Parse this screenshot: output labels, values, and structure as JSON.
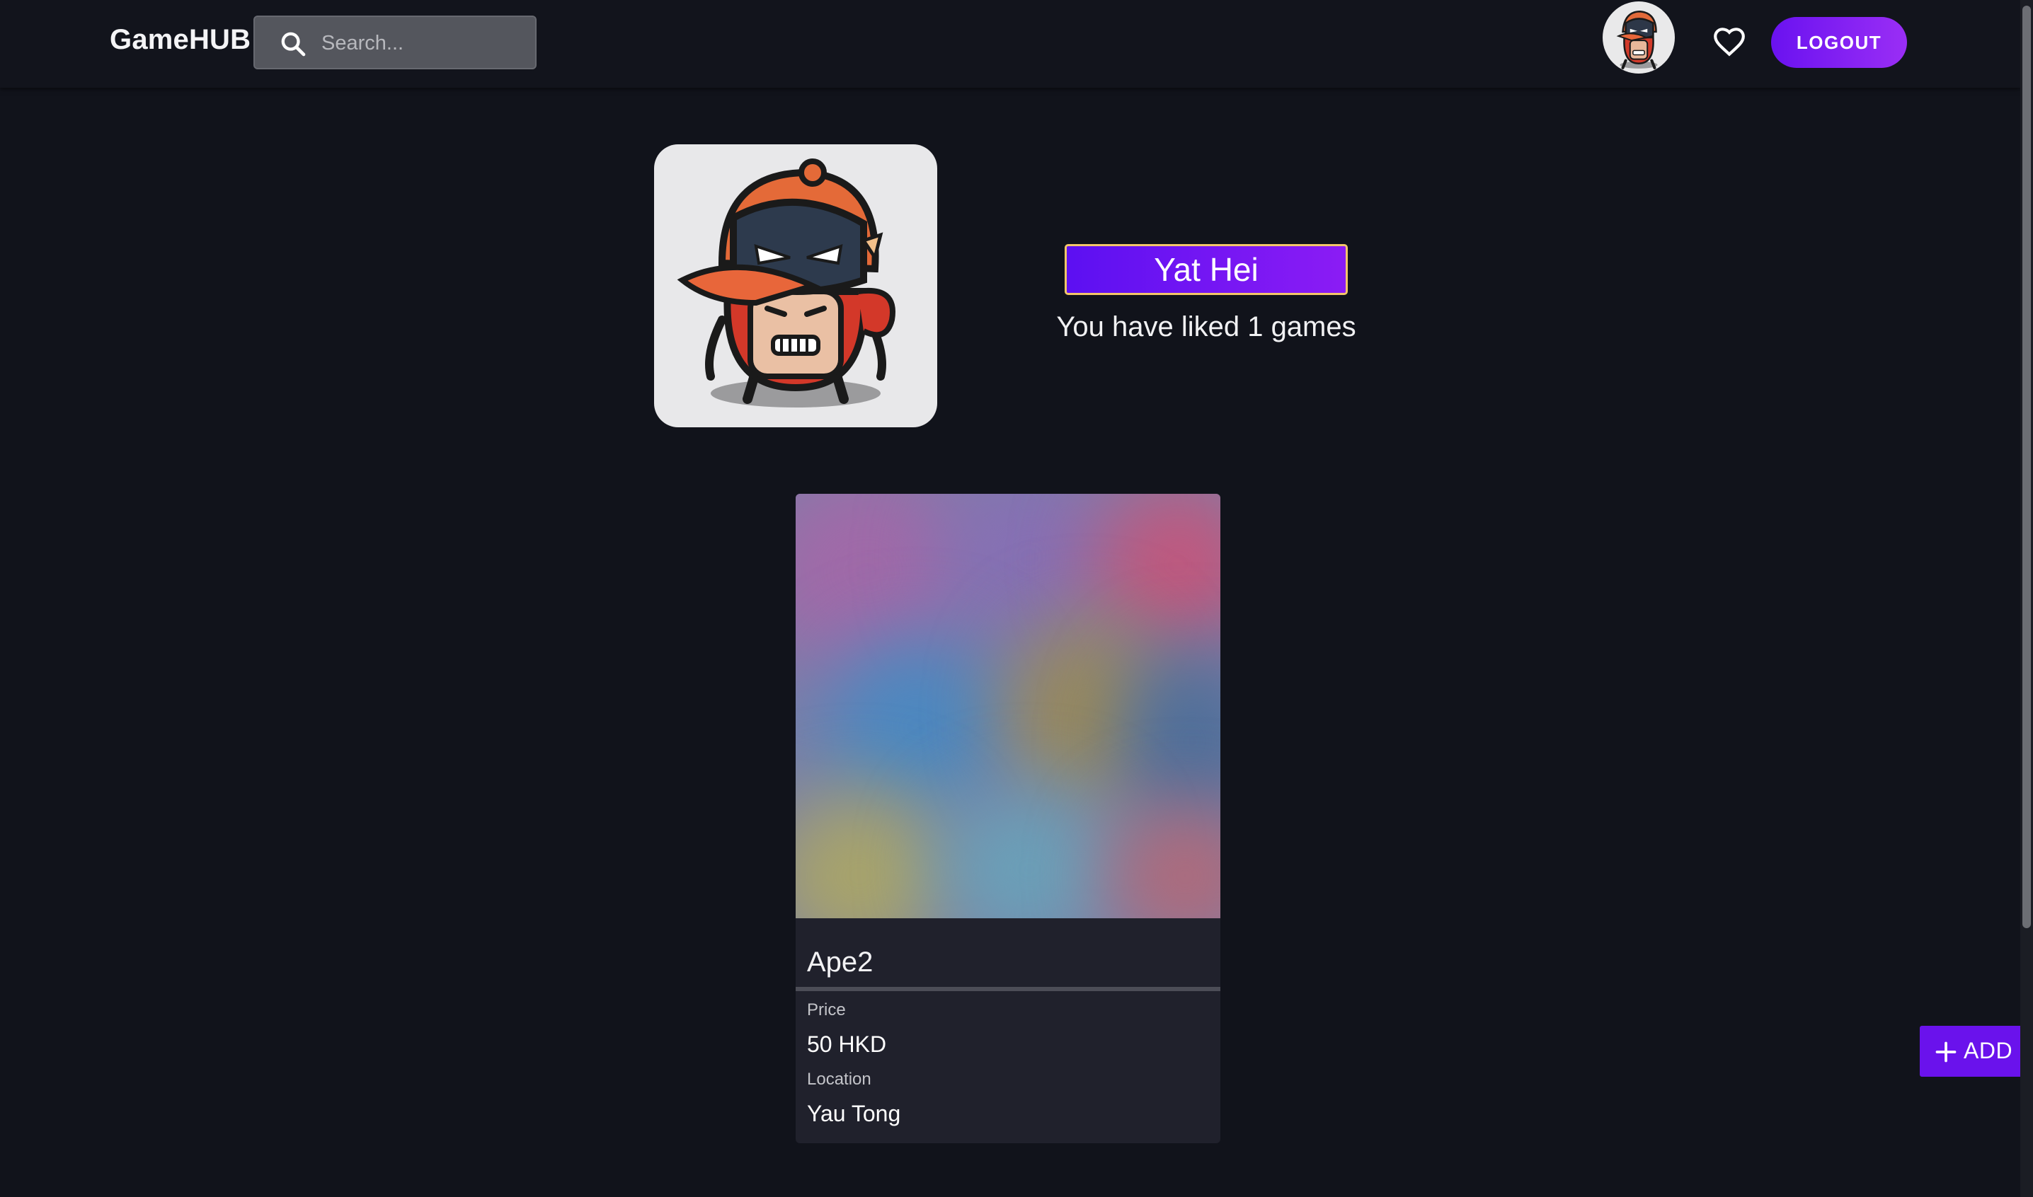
{
  "header": {
    "brand": "GameHUB",
    "search": {
      "placeholder": "Search...",
      "value": ""
    },
    "icons": {
      "search": "search-icon",
      "favorites": "heart-outline-icon"
    },
    "logout_label": "LOGOUT"
  },
  "profile": {
    "username": "Yat Hei",
    "liked_text": "You have liked 1 games"
  },
  "liked_games": [
    {
      "title": "Ape2",
      "price_label": "Price",
      "price": "50 HKD",
      "location_label": "Location",
      "location": "Yau Tong"
    }
  ],
  "fab": {
    "label": "ADD",
    "icon": "plus-icon"
  },
  "colors": {
    "background": "#11131b",
    "topbar": "#12141c",
    "accent": "#6a12ec",
    "accent_gradient_end": "#9a2ef5",
    "username_border": "#f4c66a",
    "card": "#20212c"
  }
}
